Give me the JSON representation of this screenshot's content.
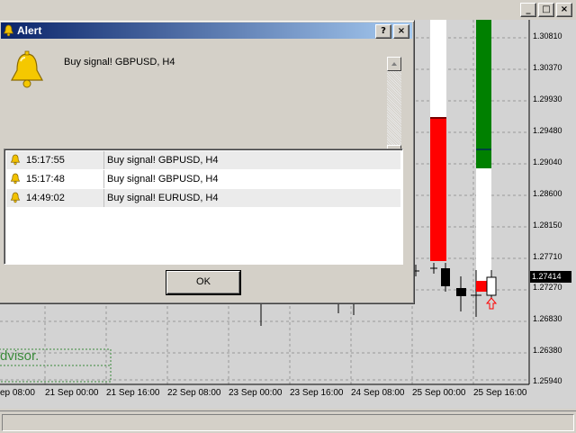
{
  "alert": {
    "title": "Alert",
    "help_button": "?",
    "close_button": "×",
    "message": "Buy signal! GBPUSD, H4",
    "ok_label": "OK",
    "rows": [
      {
        "time": "15:17:55",
        "message": "Buy signal! GBPUSD, H4"
      },
      {
        "time": "15:17:48",
        "message": "Buy signal! GBPUSD, H4"
      },
      {
        "time": "14:49:02",
        "message": "Buy signal! EURUSD, H4"
      }
    ]
  },
  "window_controls": {
    "minimize": "_",
    "restore": "□",
    "close": "×"
  },
  "chart": {
    "price_labels": [
      "1.30810",
      "1.30370",
      "1.29930",
      "1.29480",
      "1.29040",
      "1.28600",
      "1.28150",
      "1.27710",
      "1.27270",
      "1.26830",
      "1.26380",
      "1.25940"
    ],
    "current_price": "1.27414",
    "time_labels": [
      "ep 08:00",
      "21 Sep 00:00",
      "21 Sep 16:00",
      "22 Sep 08:00",
      "23 Sep 00:00",
      "23 Sep 16:00",
      "24 Sep 08:00",
      "25 Sep 00:00",
      "25 Sep 16:00"
    ],
    "ea_text": "dvisor."
  }
}
